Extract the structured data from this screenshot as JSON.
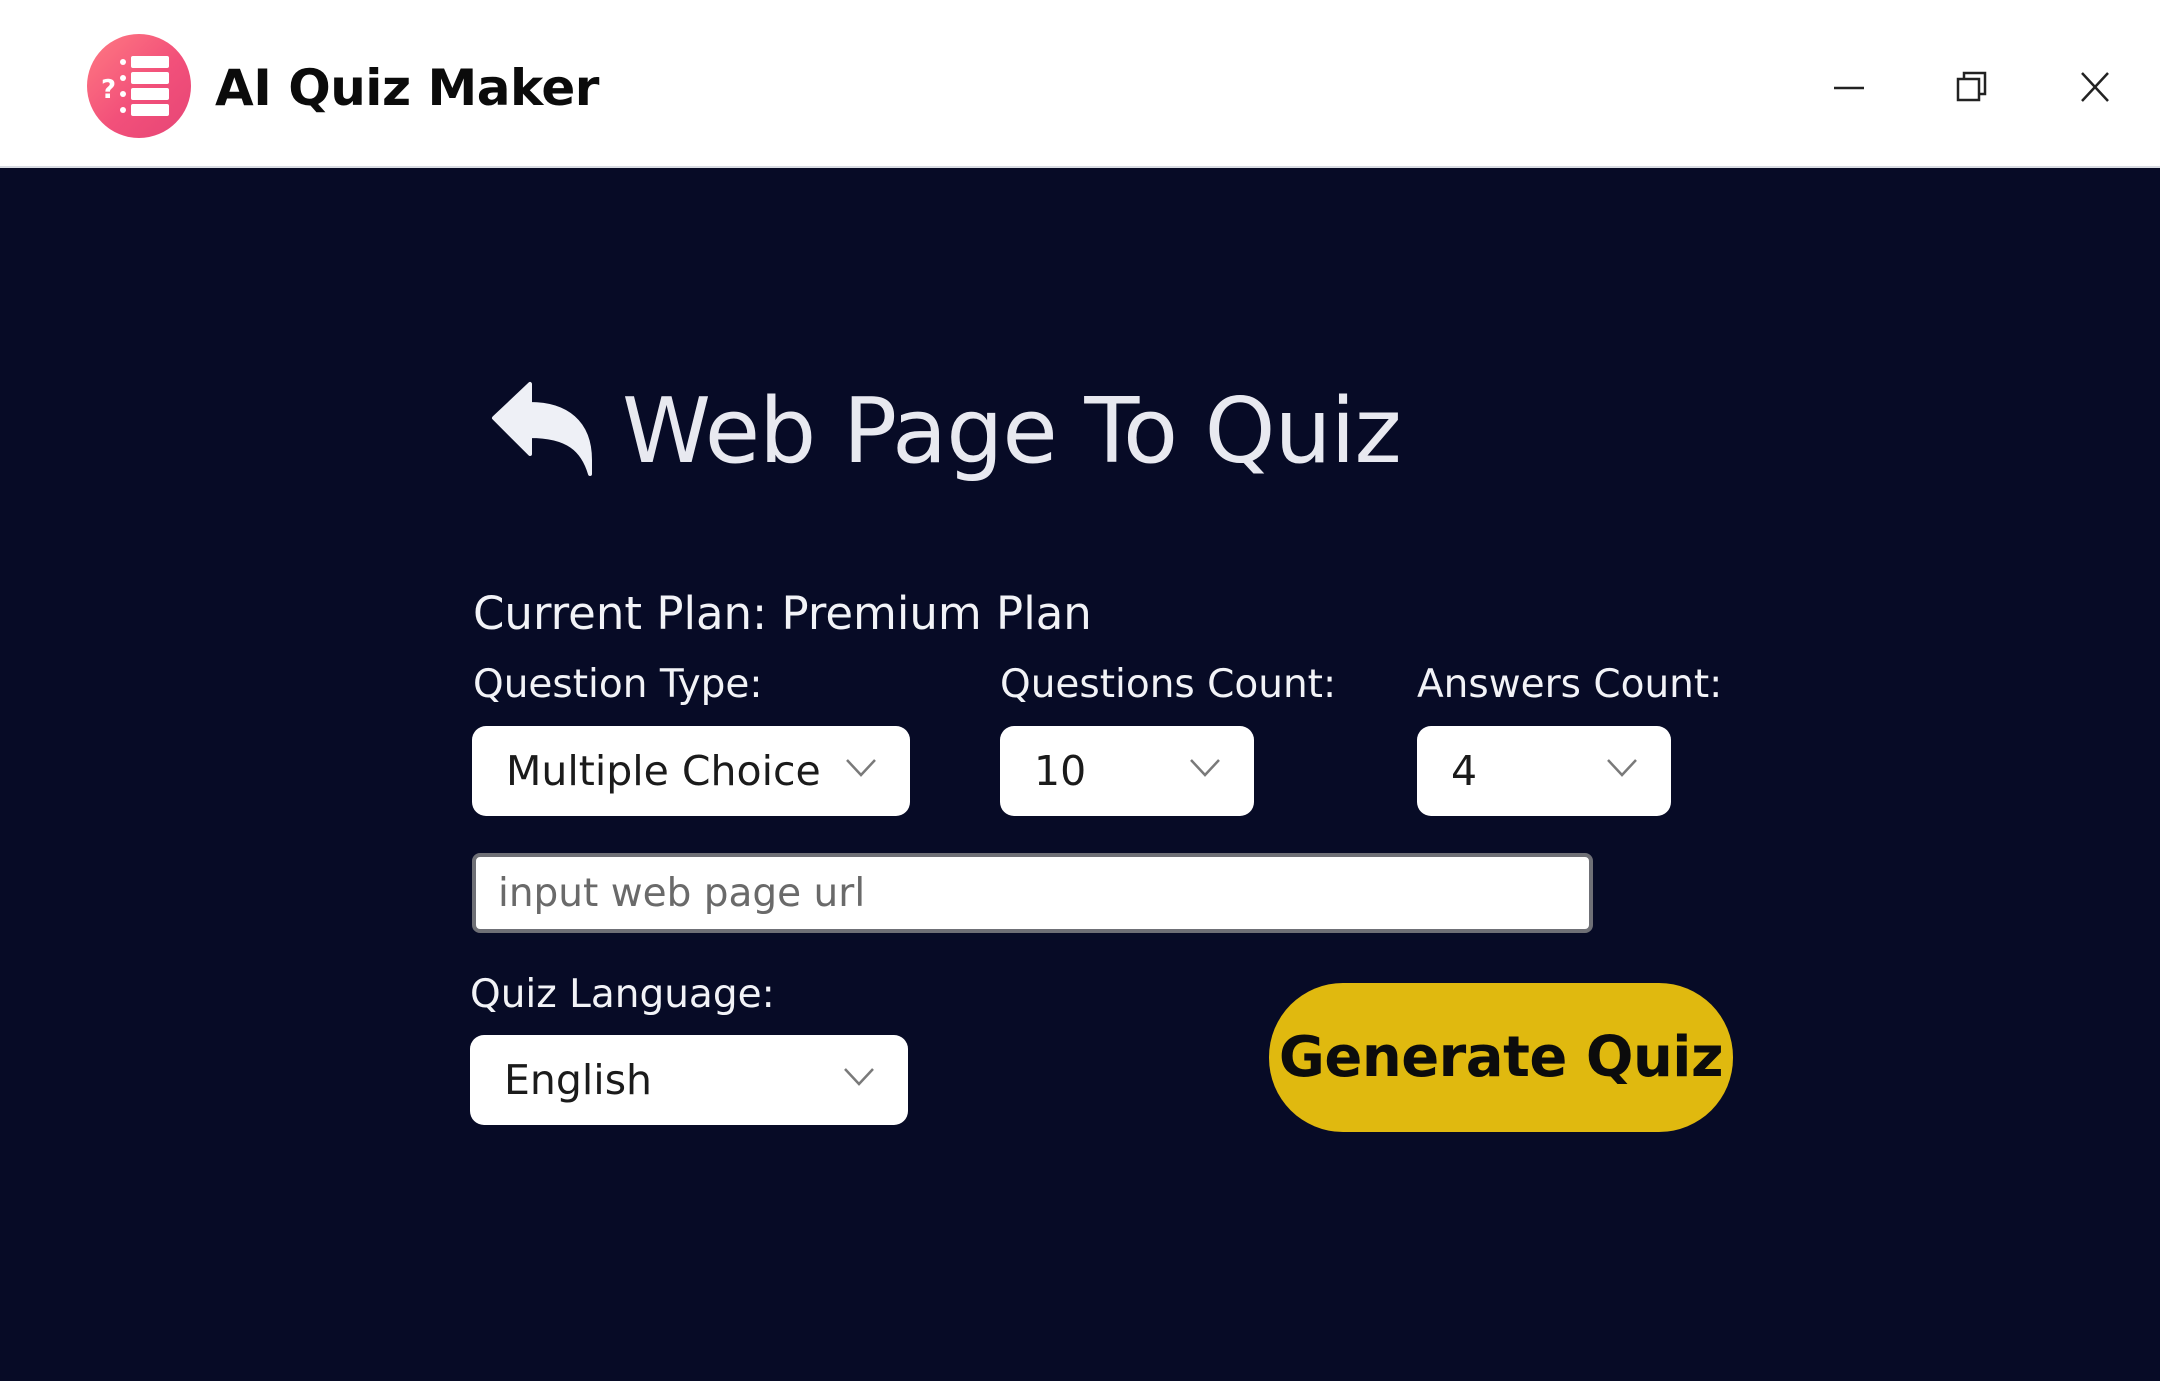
{
  "titlebar": {
    "app_title": "AI Quiz Maker",
    "logo_icon": "quiz-list-icon",
    "logo_colors": [
      "#ff7a82",
      "#e64576"
    ],
    "controls": {
      "minimize": "minimize-icon",
      "maximize": "restore-icon",
      "close": "close-icon"
    }
  },
  "header": {
    "back_icon": "back-arrow-icon",
    "title": "Web Page To Quiz"
  },
  "plan": {
    "text": "Current Plan: Premium Plan"
  },
  "question_type": {
    "label": "Question Type:",
    "value": "Multiple Choice"
  },
  "questions_count": {
    "label": "Questions Count:",
    "value": "10"
  },
  "answers_count": {
    "label": "Answers Count:",
    "value": "4"
  },
  "url_input": {
    "placeholder": "input web page url",
    "value": ""
  },
  "quiz_language": {
    "label": "Quiz Language:",
    "value": "English"
  },
  "generate": {
    "label": "Generate Quiz"
  },
  "colors": {
    "background": "#070b26",
    "accent_button": "#e0b90f",
    "titlebar": "#ffffff"
  }
}
